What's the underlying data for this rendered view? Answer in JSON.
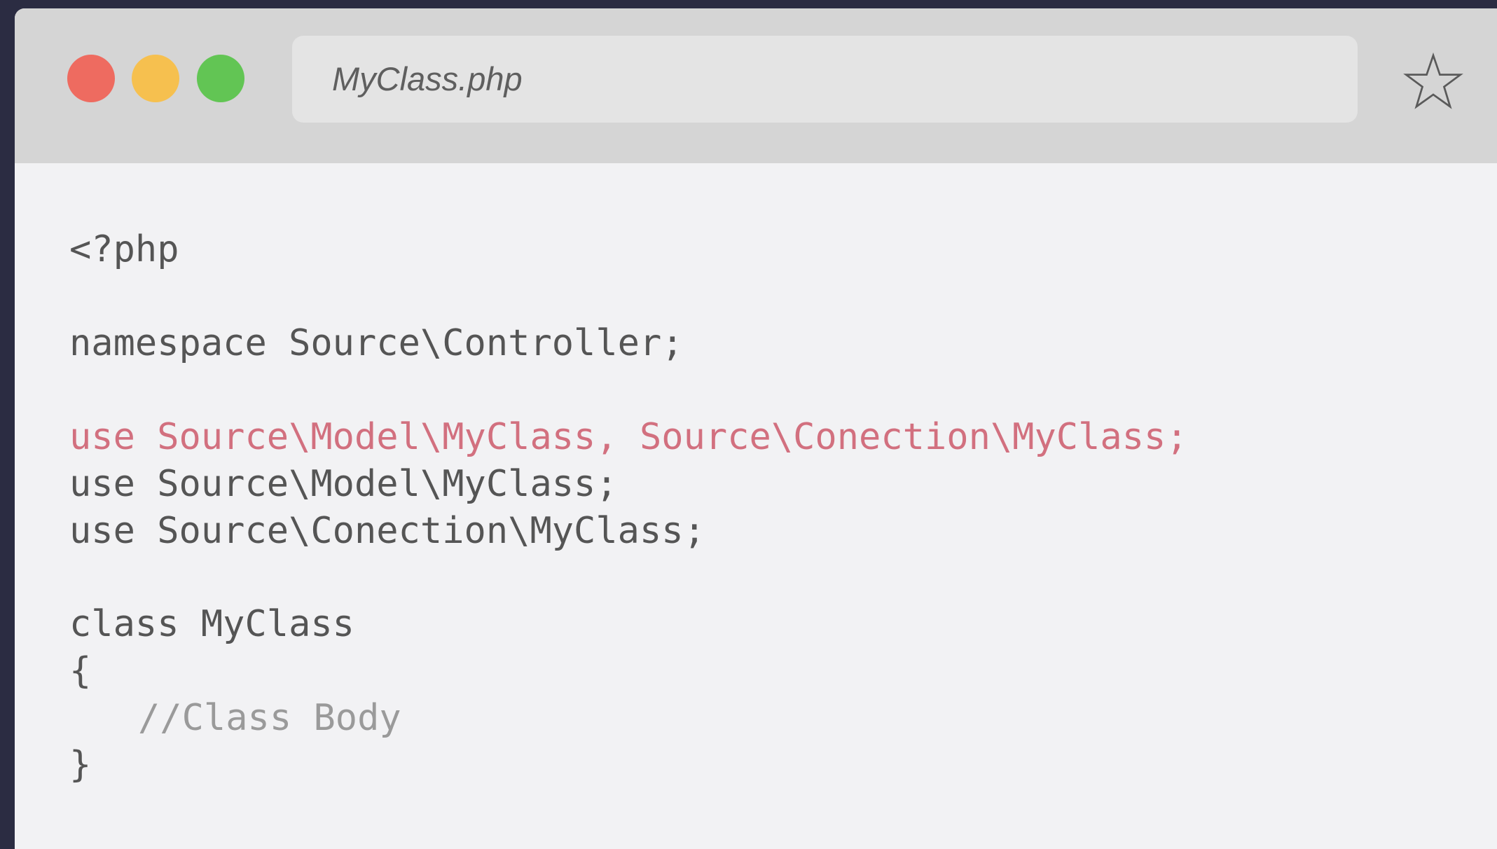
{
  "window": {
    "tab_title": "MyClass.php"
  },
  "controls": {
    "close_color": "#ee6b60",
    "minimize_color": "#f6c04f",
    "maximize_color": "#62c554"
  },
  "icons": {
    "bookmark": "star-icon"
  },
  "colors": {
    "code_text": "#555555",
    "highlight": "#d2707f",
    "comment": "#9a9a9a",
    "editor_bg": "#f2f2f4",
    "titlebar_bg": "#d5d5d5"
  },
  "code": {
    "lines": [
      "<?php",
      "namespace Source\\Controller;",
      "use Source\\Model\\MyClass, Source\\Conection\\MyClass;",
      "use Source\\Model\\MyClass;",
      "use Source\\Conection\\MyClass;",
      "class MyClass",
      "{",
      "//Class Body",
      "}"
    ]
  }
}
